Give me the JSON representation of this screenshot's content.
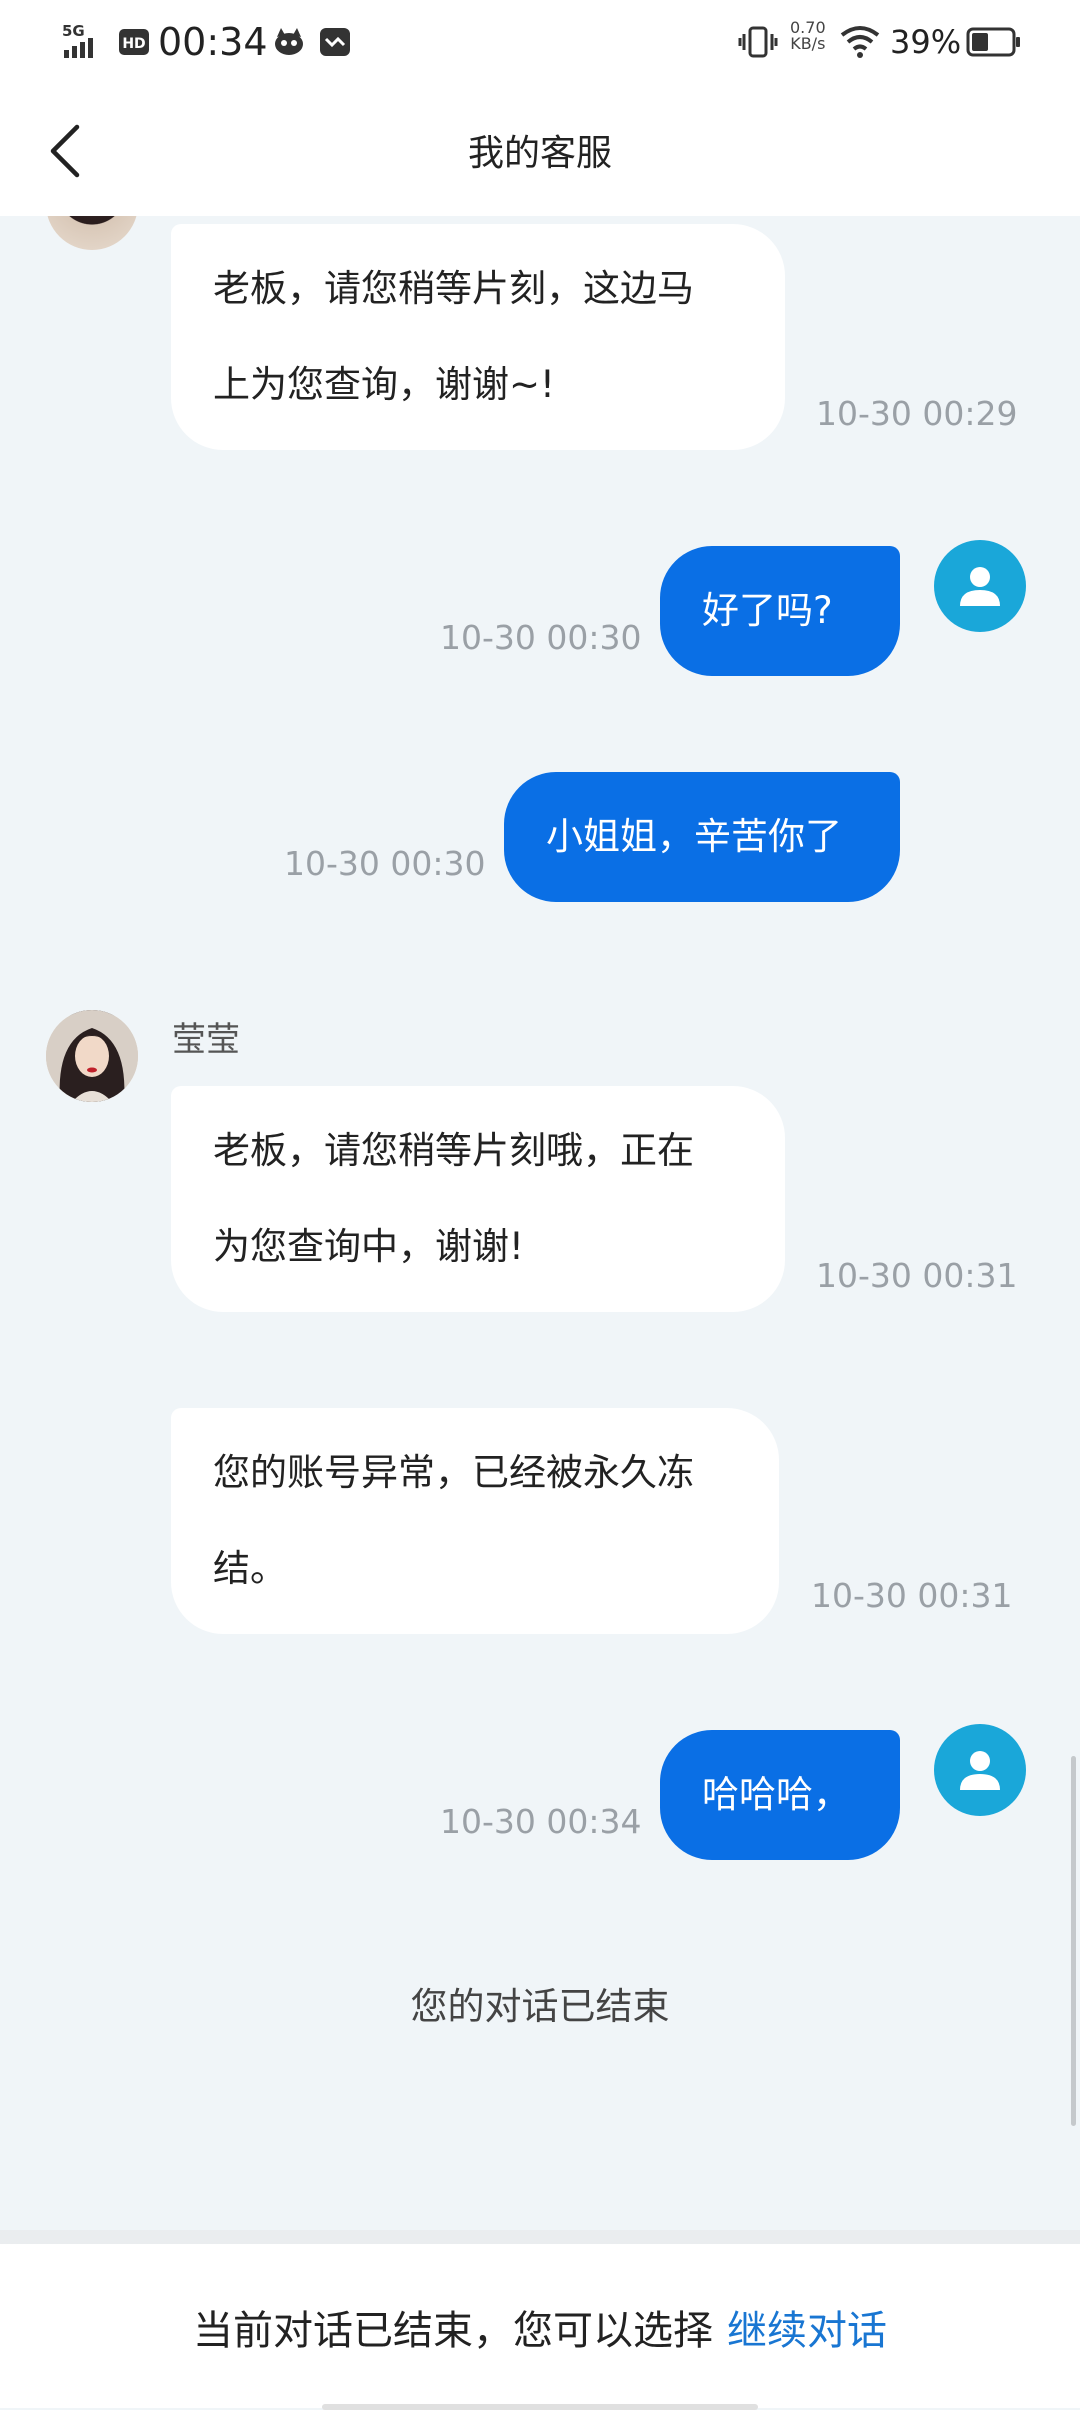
{
  "status_bar": {
    "network": "5G",
    "hd": "HD",
    "time": "00:34",
    "speed_value": "0.70",
    "speed_unit": "KB/s",
    "battery_percent": "39%"
  },
  "nav": {
    "title": "我的客服"
  },
  "agent": {
    "name": "莹莹"
  },
  "messages": [
    {
      "from": "agent",
      "lines": [
        "老板，请您稍等片刻，这边马",
        "上为您查询，谢谢~!"
      ],
      "time": "10-30 00:29"
    },
    {
      "from": "user",
      "text": "好了吗?",
      "time": "10-30 00:30"
    },
    {
      "from": "user",
      "text": "小姐姐，辛苦你了",
      "time": "10-30 00:30"
    },
    {
      "from": "agent",
      "lines": [
        "老板，请您稍等片刻哦，正在",
        "为您查询中，谢谢!"
      ],
      "time": "10-30 00:31"
    },
    {
      "from": "agent",
      "lines": [
        "您的账号异常，已经被永久冻",
        "结。"
      ],
      "time": "10-30 00:31"
    },
    {
      "from": "user",
      "text": "哈哈哈，",
      "time": "10-30 00:34"
    }
  ],
  "end_notice": "您的对话已结束",
  "bottom": {
    "prompt": "当前对话已结束，您可以选择",
    "continue_label": "继续对话"
  },
  "colors": {
    "user_bubble": "#0A6FE5",
    "user_avatar": "#1AA7D9",
    "link": "#1976D2",
    "chat_bg": "#F0F5F8"
  }
}
